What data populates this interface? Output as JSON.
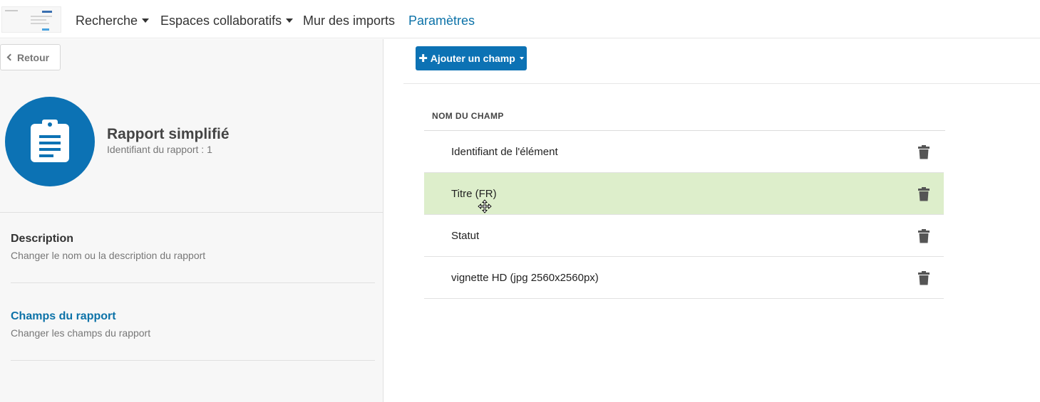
{
  "nav": {
    "items": [
      {
        "label": "Recherche",
        "has_caret": true
      },
      {
        "label": "Espaces collaboratifs",
        "has_caret": true
      },
      {
        "label": "Mur des imports",
        "has_caret": false
      },
      {
        "label": "Paramètres",
        "active": true
      }
    ]
  },
  "sidebar": {
    "back_label": "Retour",
    "report": {
      "title": "Rapport simplifié",
      "subtitle": "Identifiant du rapport : 1",
      "icon": "clipboard-icon"
    },
    "menu": [
      {
        "title": "Description",
        "desc": "Changer le nom ou la description du rapport",
        "active": false
      },
      {
        "title": "Champs du rapport",
        "desc": "Changer les champs du rapport",
        "active": true
      }
    ]
  },
  "main": {
    "add_button_label": "Ajouter un champ",
    "table": {
      "column_header": "NOM DU CHAMP",
      "rows": [
        {
          "label": "Identifiant de l'élément",
          "highlighted": false
        },
        {
          "label": "Titre (FR)",
          "highlighted": true
        },
        {
          "label": "Statut",
          "highlighted": false
        },
        {
          "label": "vignette HD (jpg 2560x2560px)",
          "highlighted": false
        }
      ]
    }
  },
  "colors": {
    "accent": "#0c72b4",
    "highlight_row": "#ddeecb"
  }
}
